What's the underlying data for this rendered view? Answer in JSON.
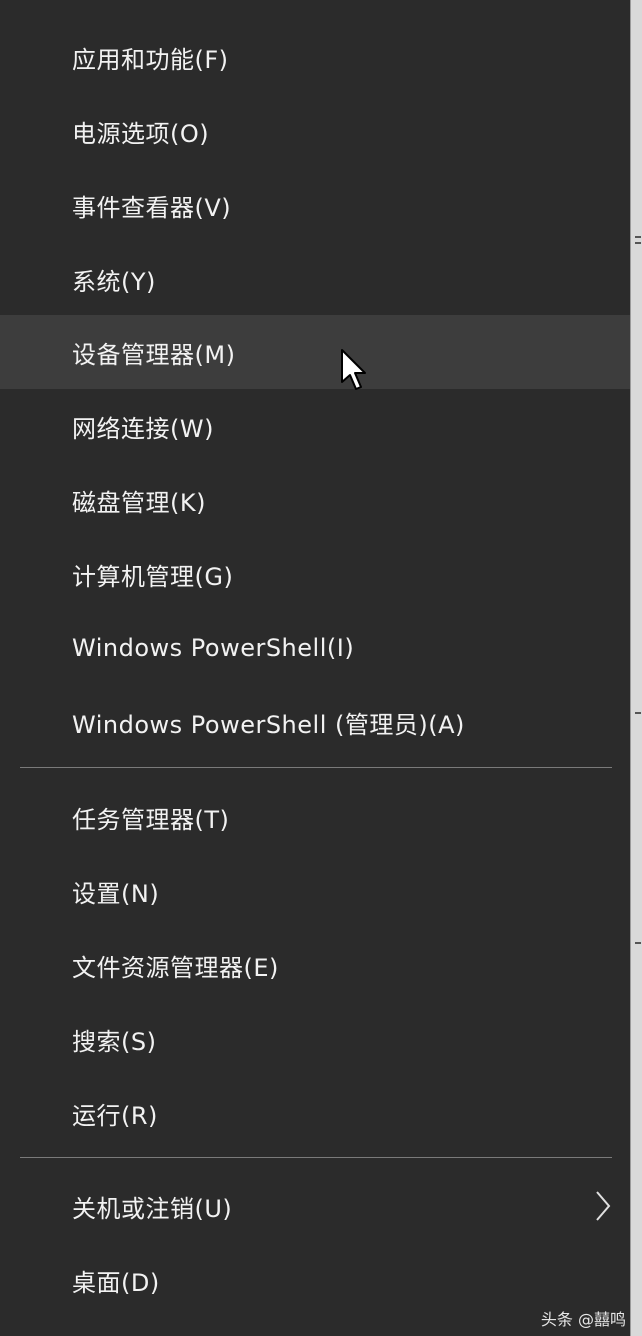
{
  "menu": {
    "items": [
      {
        "label": "应用和功能(F)"
      },
      {
        "label": "电源选项(O)"
      },
      {
        "label": "事件查看器(V)"
      },
      {
        "label": "系统(Y)"
      },
      {
        "label": "设备管理器(M)"
      },
      {
        "label": "网络连接(W)"
      },
      {
        "label": "磁盘管理(K)"
      },
      {
        "label": "计算机管理(G)"
      },
      {
        "label": "Windows PowerShell(I)"
      },
      {
        "label": "Windows PowerShell (管理员)(A)"
      },
      {
        "label": "任务管理器(T)"
      },
      {
        "label": "设置(N)"
      },
      {
        "label": "文件资源管理器(E)"
      },
      {
        "label": "搜索(S)"
      },
      {
        "label": "运行(R)"
      },
      {
        "label": "关机或注销(U)"
      },
      {
        "label": "桌面(D)"
      }
    ],
    "hovered_item": "设备管理器(M)",
    "submenu_icon": "chevron-right-icon"
  },
  "watermark": {
    "text": "头条 @囍鸣"
  },
  "colors": {
    "background": "#2b2b2b",
    "hover": "#3d3d3d",
    "text": "#f2f2f2",
    "divider": "#7a7a7a"
  }
}
